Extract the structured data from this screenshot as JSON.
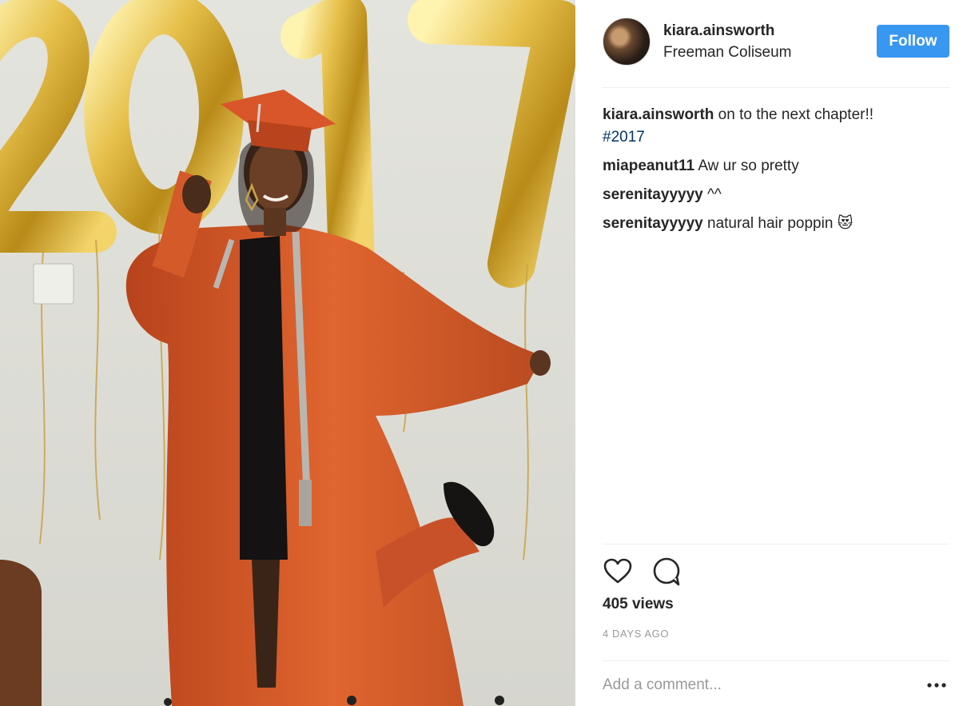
{
  "post": {
    "username": "kiara.ainsworth",
    "location": "Freeman Coliseum",
    "follow_label": "Follow"
  },
  "comments": [
    {
      "user": "kiara.ainsworth",
      "text": "on to the next chapter!!",
      "hashtag": "#2017"
    },
    {
      "user": "miapeanut11",
      "text": "Aw ur so pretty"
    },
    {
      "user": "serenitayyyyy",
      "text": "^^"
    },
    {
      "user": "serenitayyyyy",
      "text": "natural hair poppin 😻"
    }
  ],
  "stats": {
    "views": "405 views",
    "date": "4 DAYS AGO"
  },
  "add_comment": {
    "placeholder": "Add a comment..."
  },
  "media": {
    "balloon_text": "2017"
  },
  "colors": {
    "follow_button": "#3897f0",
    "hashtag": "#003569",
    "gown": "#d65a2b",
    "balloon_gold": "#d9b23a"
  },
  "icons": [
    "heart-icon",
    "comment-bubble-icon",
    "more-options-icon"
  ]
}
